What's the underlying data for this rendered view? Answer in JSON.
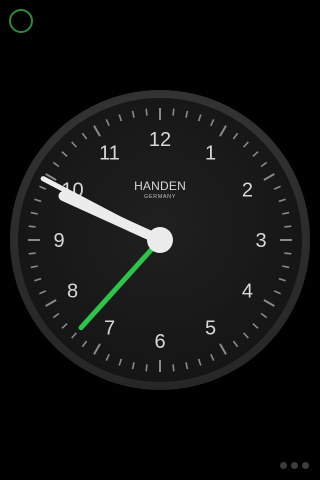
{
  "clock": {
    "brand": "HANDEN",
    "brand_sub": "GERMANY",
    "numerals": [
      "12",
      "1",
      "2",
      "3",
      "4",
      "5",
      "6",
      "7",
      "8",
      "9",
      "10",
      "11"
    ],
    "time": {
      "hour": 9,
      "minute": 49,
      "second": 37
    },
    "colors": {
      "face": "#1b1b1b",
      "bezel": "#383838",
      "hands": "#ececec",
      "second_hand": "#2ec44a",
      "status_ring": "#2e8a3c"
    }
  },
  "status_indicator": {
    "icon": "ring-icon"
  },
  "pager": {
    "count": 3
  }
}
